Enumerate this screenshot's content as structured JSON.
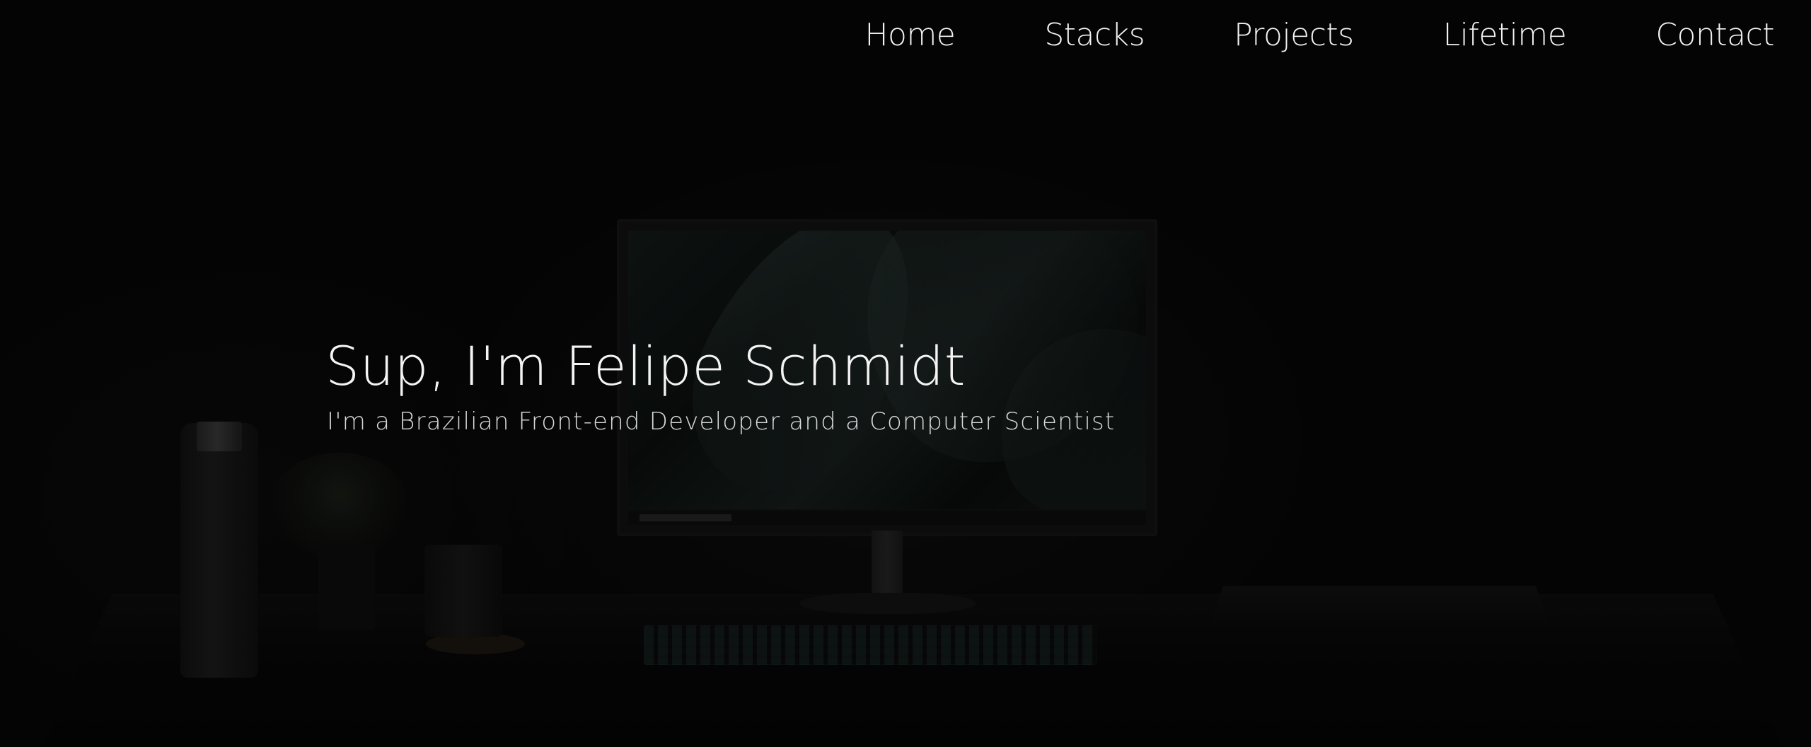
{
  "nav": {
    "items": [
      {
        "label": "Home"
      },
      {
        "label": "Stacks"
      },
      {
        "label": "Projects"
      },
      {
        "label": "Lifetime"
      },
      {
        "label": "Contact"
      }
    ]
  },
  "hero": {
    "title": "Sup, I'm Felipe Schmidt",
    "subtitle": "I'm a Brazilian Front-end Developer and a Computer Scientist"
  },
  "colors": {
    "background": "#0b0b0b",
    "text": "#f4f4f4",
    "subtext": "#d9d9d9"
  }
}
